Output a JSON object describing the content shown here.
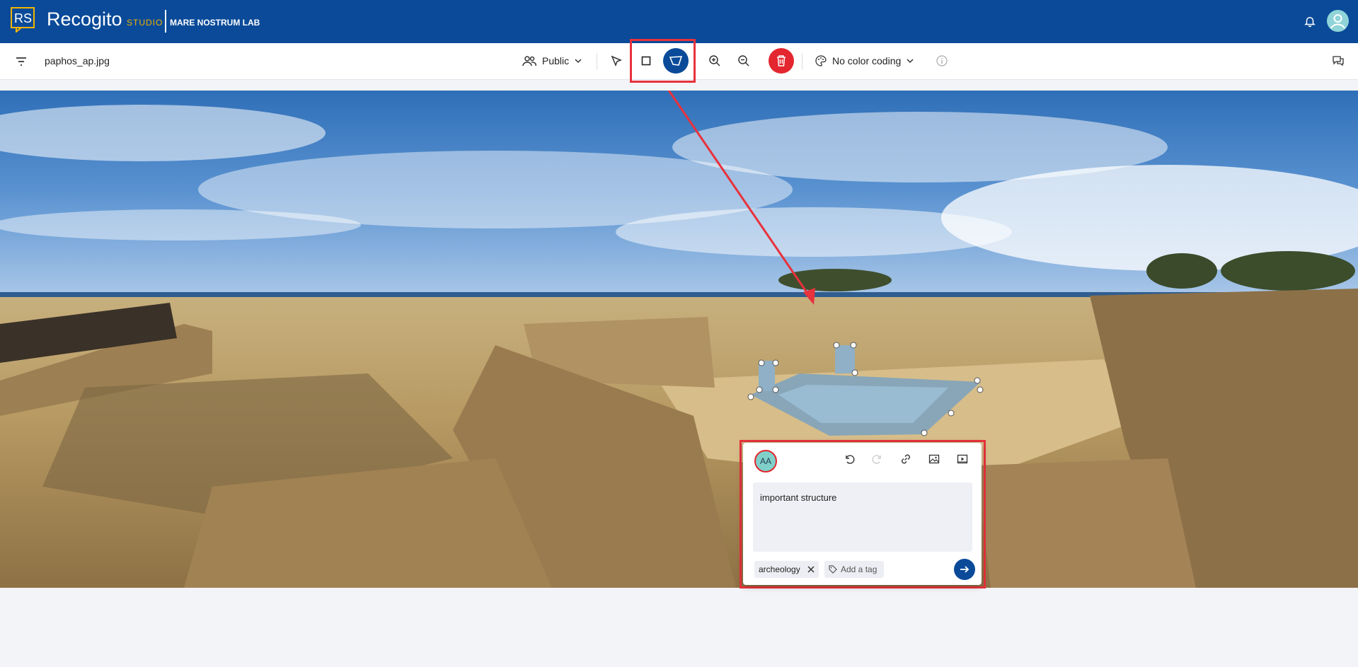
{
  "header": {
    "app_name": "Recogito",
    "app_suffix": "STUDIO",
    "logo_letters": "RS",
    "org_name": "MARE NOSTRUM LAB",
    "colors": {
      "bar": "#0a4a99",
      "accent": "#f4b400"
    }
  },
  "toolbar": {
    "filename": "paphos_ap.jpg",
    "privacy_label": "Public",
    "color_coding_label": "No color coding",
    "tools": [
      "filter-icon",
      "users-icon",
      "pointer-icon",
      "rectangle-icon",
      "polygon-icon",
      "zoom-in-icon",
      "zoom-out-icon",
      "trash-icon",
      "palette-icon",
      "info-icon",
      "comments-icon"
    ],
    "active_tool": "polygon"
  },
  "annotation": {
    "avatar_initials": "AA",
    "comment": "important structure",
    "tags": [
      "archeology"
    ],
    "add_tag_placeholder": "Add a tag"
  }
}
